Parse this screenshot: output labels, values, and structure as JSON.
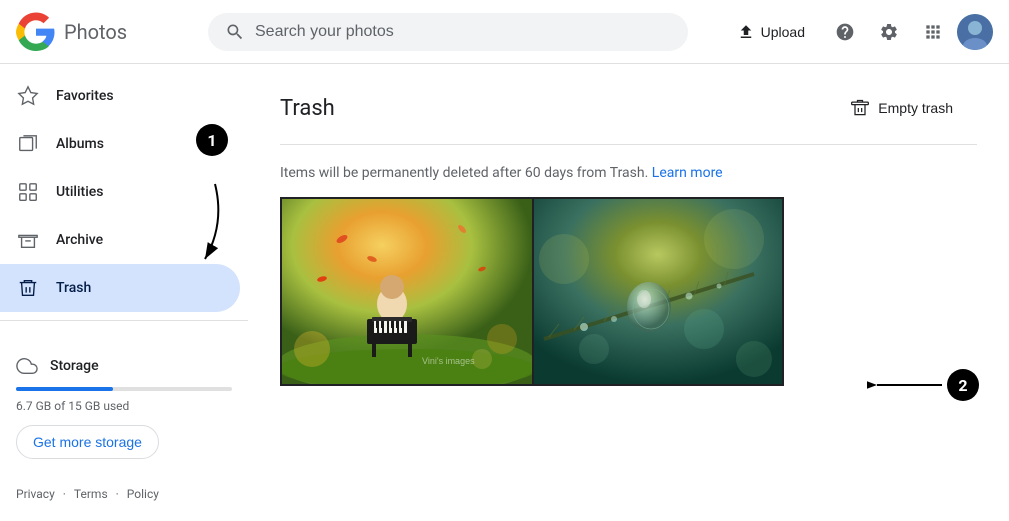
{
  "header": {
    "logo_text": "Photos",
    "search_placeholder": "Search your photos",
    "upload_label": "Upload",
    "title": "Google Photos"
  },
  "sidebar": {
    "items": [
      {
        "id": "favorites",
        "label": "Favorites",
        "icon": "star"
      },
      {
        "id": "albums",
        "label": "Albums",
        "icon": "album"
      },
      {
        "id": "utilities",
        "label": "Utilities",
        "icon": "utilities"
      },
      {
        "id": "archive",
        "label": "Archive",
        "icon": "archive"
      },
      {
        "id": "trash",
        "label": "Trash",
        "icon": "trash",
        "active": true
      }
    ],
    "storage": {
      "label": "Storage",
      "used_text": "6.7 GB of 15 GB used",
      "fill_percent": 44.7,
      "get_more_label": "Get more storage"
    },
    "footer": {
      "privacy": "Privacy",
      "terms": "Terms",
      "policy": "Policy"
    }
  },
  "content": {
    "page_title": "Trash",
    "empty_trash_label": "Empty trash",
    "info_text": "Items will be permanently deleted after 60 days from Trash.",
    "learn_more_label": "Learn more",
    "annotation1": "1",
    "annotation2": "2"
  }
}
